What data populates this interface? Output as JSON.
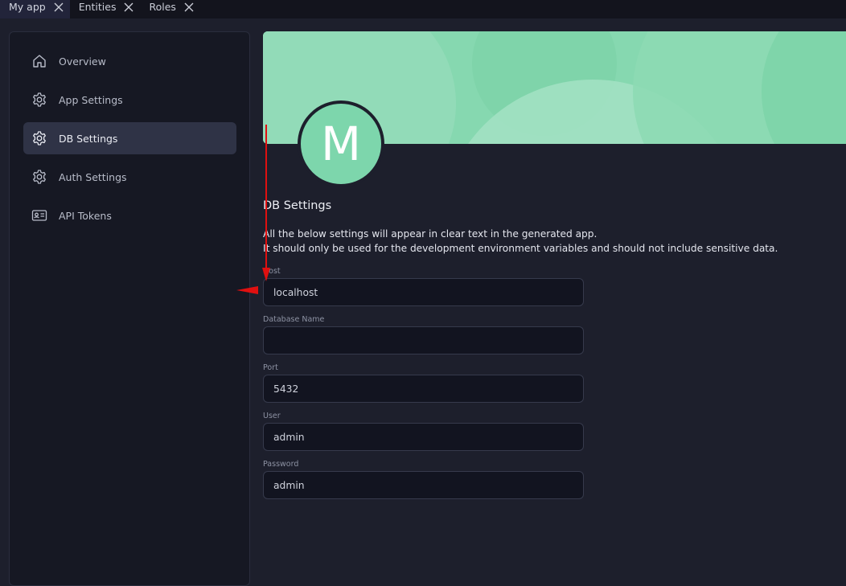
{
  "tabs": [
    {
      "label": "My app"
    },
    {
      "label": "Entities"
    },
    {
      "label": "Roles"
    }
  ],
  "sidebar": {
    "items": [
      {
        "label": "Overview",
        "icon": "home-icon"
      },
      {
        "label": "App Settings",
        "icon": "gear-icon"
      },
      {
        "label": "DB Settings",
        "icon": "gear-icon",
        "active": true
      },
      {
        "label": "Auth Settings",
        "icon": "gear-icon"
      },
      {
        "label": "API Tokens",
        "icon": "id-card-icon"
      }
    ]
  },
  "main": {
    "avatar_letter": "M",
    "title": "DB Settings",
    "description_line1": "All the below settings will appear in clear text in the generated app.",
    "description_line2": "It should only be used for the development environment variables and should not include sensitive data.",
    "fields": [
      {
        "label": "Host",
        "value": "localhost"
      },
      {
        "label": "Database Name",
        "value": ""
      },
      {
        "label": "Port",
        "value": "5432"
      },
      {
        "label": "User",
        "value": "admin"
      },
      {
        "label": "Password",
        "value": "admin"
      }
    ]
  },
  "colors": {
    "banner": "#86d8b0",
    "avatar": "#7dd6ac",
    "active_item": "#2f3346",
    "annotation_arrow": "#e01010"
  }
}
